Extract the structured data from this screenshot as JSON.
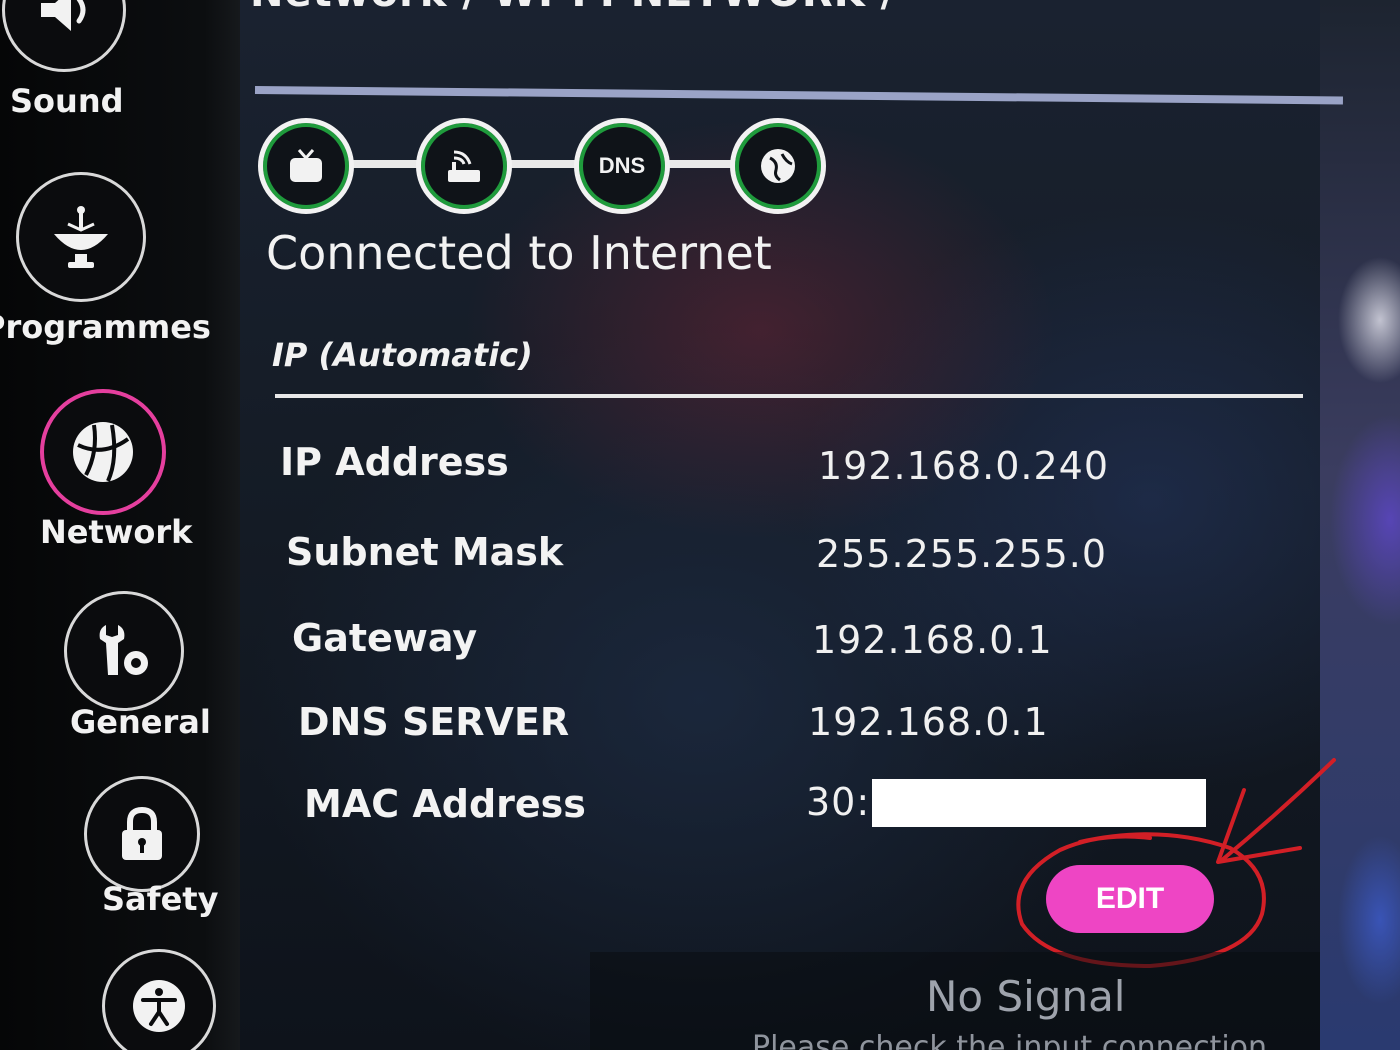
{
  "sidebar": {
    "items": [
      {
        "label": "Sound",
        "icon": "speaker-icon",
        "active": false
      },
      {
        "label": "Programmes",
        "icon": "satellite-dish-icon",
        "active": false
      },
      {
        "label": "Network",
        "icon": "globe-icon",
        "active": true
      },
      {
        "label": "General",
        "icon": "wrench-gear-icon",
        "active": false
      },
      {
        "label": "Safety",
        "icon": "lock-icon",
        "active": false
      },
      {
        "label": "",
        "icon": "accessibility-icon",
        "active": false
      }
    ]
  },
  "header": {
    "breadcrumb": "Network / WI-FI NETWORK /"
  },
  "connection": {
    "chain": [
      "tv-icon",
      "router-icon",
      "DNS",
      "internet-globe-icon"
    ],
    "dns_label": "DNS",
    "status": "Connected to Internet",
    "status_color": "#1f9b3c"
  },
  "ip": {
    "mode": "IP (Automatic)",
    "rows": [
      {
        "label": "IP Address",
        "value": "192.168.0.240"
      },
      {
        "label": "Subnet Mask",
        "value": "255.255.255.0"
      },
      {
        "label": "Gateway",
        "value": "192.168.0.1"
      },
      {
        "label": "DNS SERVER",
        "value": "192.168.0.1"
      },
      {
        "label": "MAC Address",
        "value": "30:"
      }
    ]
  },
  "actions": {
    "edit_label": "EDIT",
    "edit_color": "#ee45c4"
  },
  "annotation": {
    "color": "#d21f26"
  },
  "signal": {
    "title": "No Signal",
    "subtitle": "Please check the input connection"
  },
  "colors": {
    "active_ring": "#e53f9e",
    "rule": "#9aa3c6"
  }
}
